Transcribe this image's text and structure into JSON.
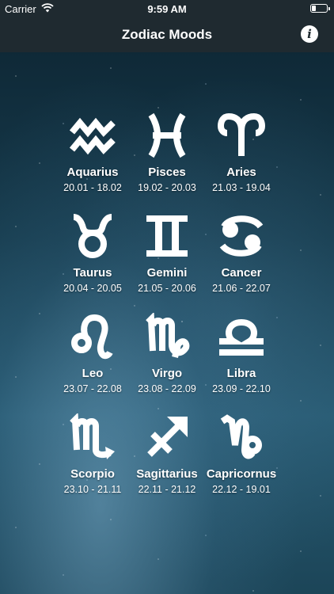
{
  "status_bar": {
    "carrier": "Carrier",
    "time": "9:59 AM",
    "battery_level": 0.25
  },
  "nav": {
    "title": "Zodiac Moods",
    "info_icon": "i"
  },
  "signs": [
    {
      "name": "Aquarius",
      "dates": "20.01 - 18.02",
      "icon": "aquarius-icon"
    },
    {
      "name": "Pisces",
      "dates": "19.02 - 20.03",
      "icon": "pisces-icon"
    },
    {
      "name": "Aries",
      "dates": "21.03 - 19.04",
      "icon": "aries-icon"
    },
    {
      "name": "Taurus",
      "dates": "20.04 - 20.05",
      "icon": "taurus-icon"
    },
    {
      "name": "Gemini",
      "dates": "21.05 - 20.06",
      "icon": "gemini-icon"
    },
    {
      "name": "Cancer",
      "dates": "21.06 - 22.07",
      "icon": "cancer-icon"
    },
    {
      "name": "Leo",
      "dates": "23.07 - 22.08",
      "icon": "leo-icon"
    },
    {
      "name": "Virgo",
      "dates": "23.08 - 22.09",
      "icon": "virgo-icon"
    },
    {
      "name": "Libra",
      "dates": "23.09 - 22.10",
      "icon": "libra-icon"
    },
    {
      "name": "Scorpio",
      "dates": "23.10 - 21.11",
      "icon": "scorpio-icon"
    },
    {
      "name": "Sagittarius",
      "dates": "22.11 - 21.12",
      "icon": "sagittarius-icon"
    },
    {
      "name": "Capricornus",
      "dates": "22.12 - 19.01",
      "icon": "capricorn-icon"
    }
  ],
  "colors": {
    "bar": "#1f2a30",
    "text": "#ffffff"
  }
}
